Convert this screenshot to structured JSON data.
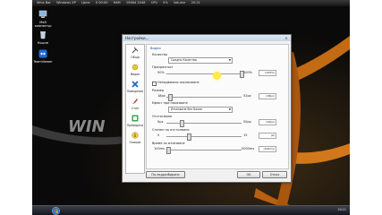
{
  "topbar": {
    "items": [
      "Wins Bar",
      "Windows XP",
      "Цена",
      "0  00:00",
      "RAM",
      "19484  2048",
      "CPU",
      "5%",
      "Volume",
      "20:21"
    ]
  },
  "desktop": {
    "icons": [
      {
        "label": "Мой компютър",
        "icon": "computer-icon"
      },
      {
        "label": "Кошче",
        "icon": "recycle-bin-icon"
      },
      {
        "label": "TeamViewer",
        "icon": "teamviewer-icon"
      }
    ],
    "wallpaper_text": "WIN"
  },
  "dialog": {
    "title": "Настройки...",
    "close": "×",
    "sidebar": [
      {
        "label": "Общи",
        "icon": "tools-icon"
      },
      {
        "label": "Видео",
        "icon": "video-icon"
      },
      {
        "label": "Поведение",
        "icon": "behavior-icon"
      },
      {
        "label": "Стил",
        "icon": "style-icon"
      },
      {
        "label": "Преводачи",
        "icon": "translate-icon"
      },
      {
        "label": "Опиции",
        "icon": "info-icon"
      }
    ],
    "panel": {
      "tab": "Видео",
      "quality_label": "Качество",
      "quality_value": "Средно Качество",
      "transparency_label": "Прозрачност",
      "transparency_min": "50%",
      "transparency_max": "100%",
      "transparency_value": "(100%)",
      "transparency_level": 1.0,
      "hide_checkbox_label": "Неподвижно заключване",
      "size_label": "Размер",
      "size_min": "18px",
      "size_max": "52px",
      "size_value": "(18px)",
      "size_level": 0.05,
      "effect_label": "Ефект при показване",
      "effect_value": "Изчезване без Балон",
      "shadow_label": "Отстъпване",
      "shadow_min": "0px",
      "shadow_max": "50px",
      "shadow_value": "(10px)",
      "shadow_level": 0.2,
      "offset_label": "Степен на отстъпване",
      "offset_min": "0",
      "offset_max": "15",
      "offset_value": "(0)",
      "offset_level": 0.3,
      "delay_label": "Време за изчезване",
      "delay_min": "100ms",
      "delay_max": "5000ms",
      "delay_value": "(100ms)",
      "delay_level": 0.02
    },
    "buttons": {
      "default": "По подразбиране",
      "ok": "OK",
      "cancel": "Отказ"
    }
  },
  "taskbar": {
    "clock": "20:21"
  }
}
